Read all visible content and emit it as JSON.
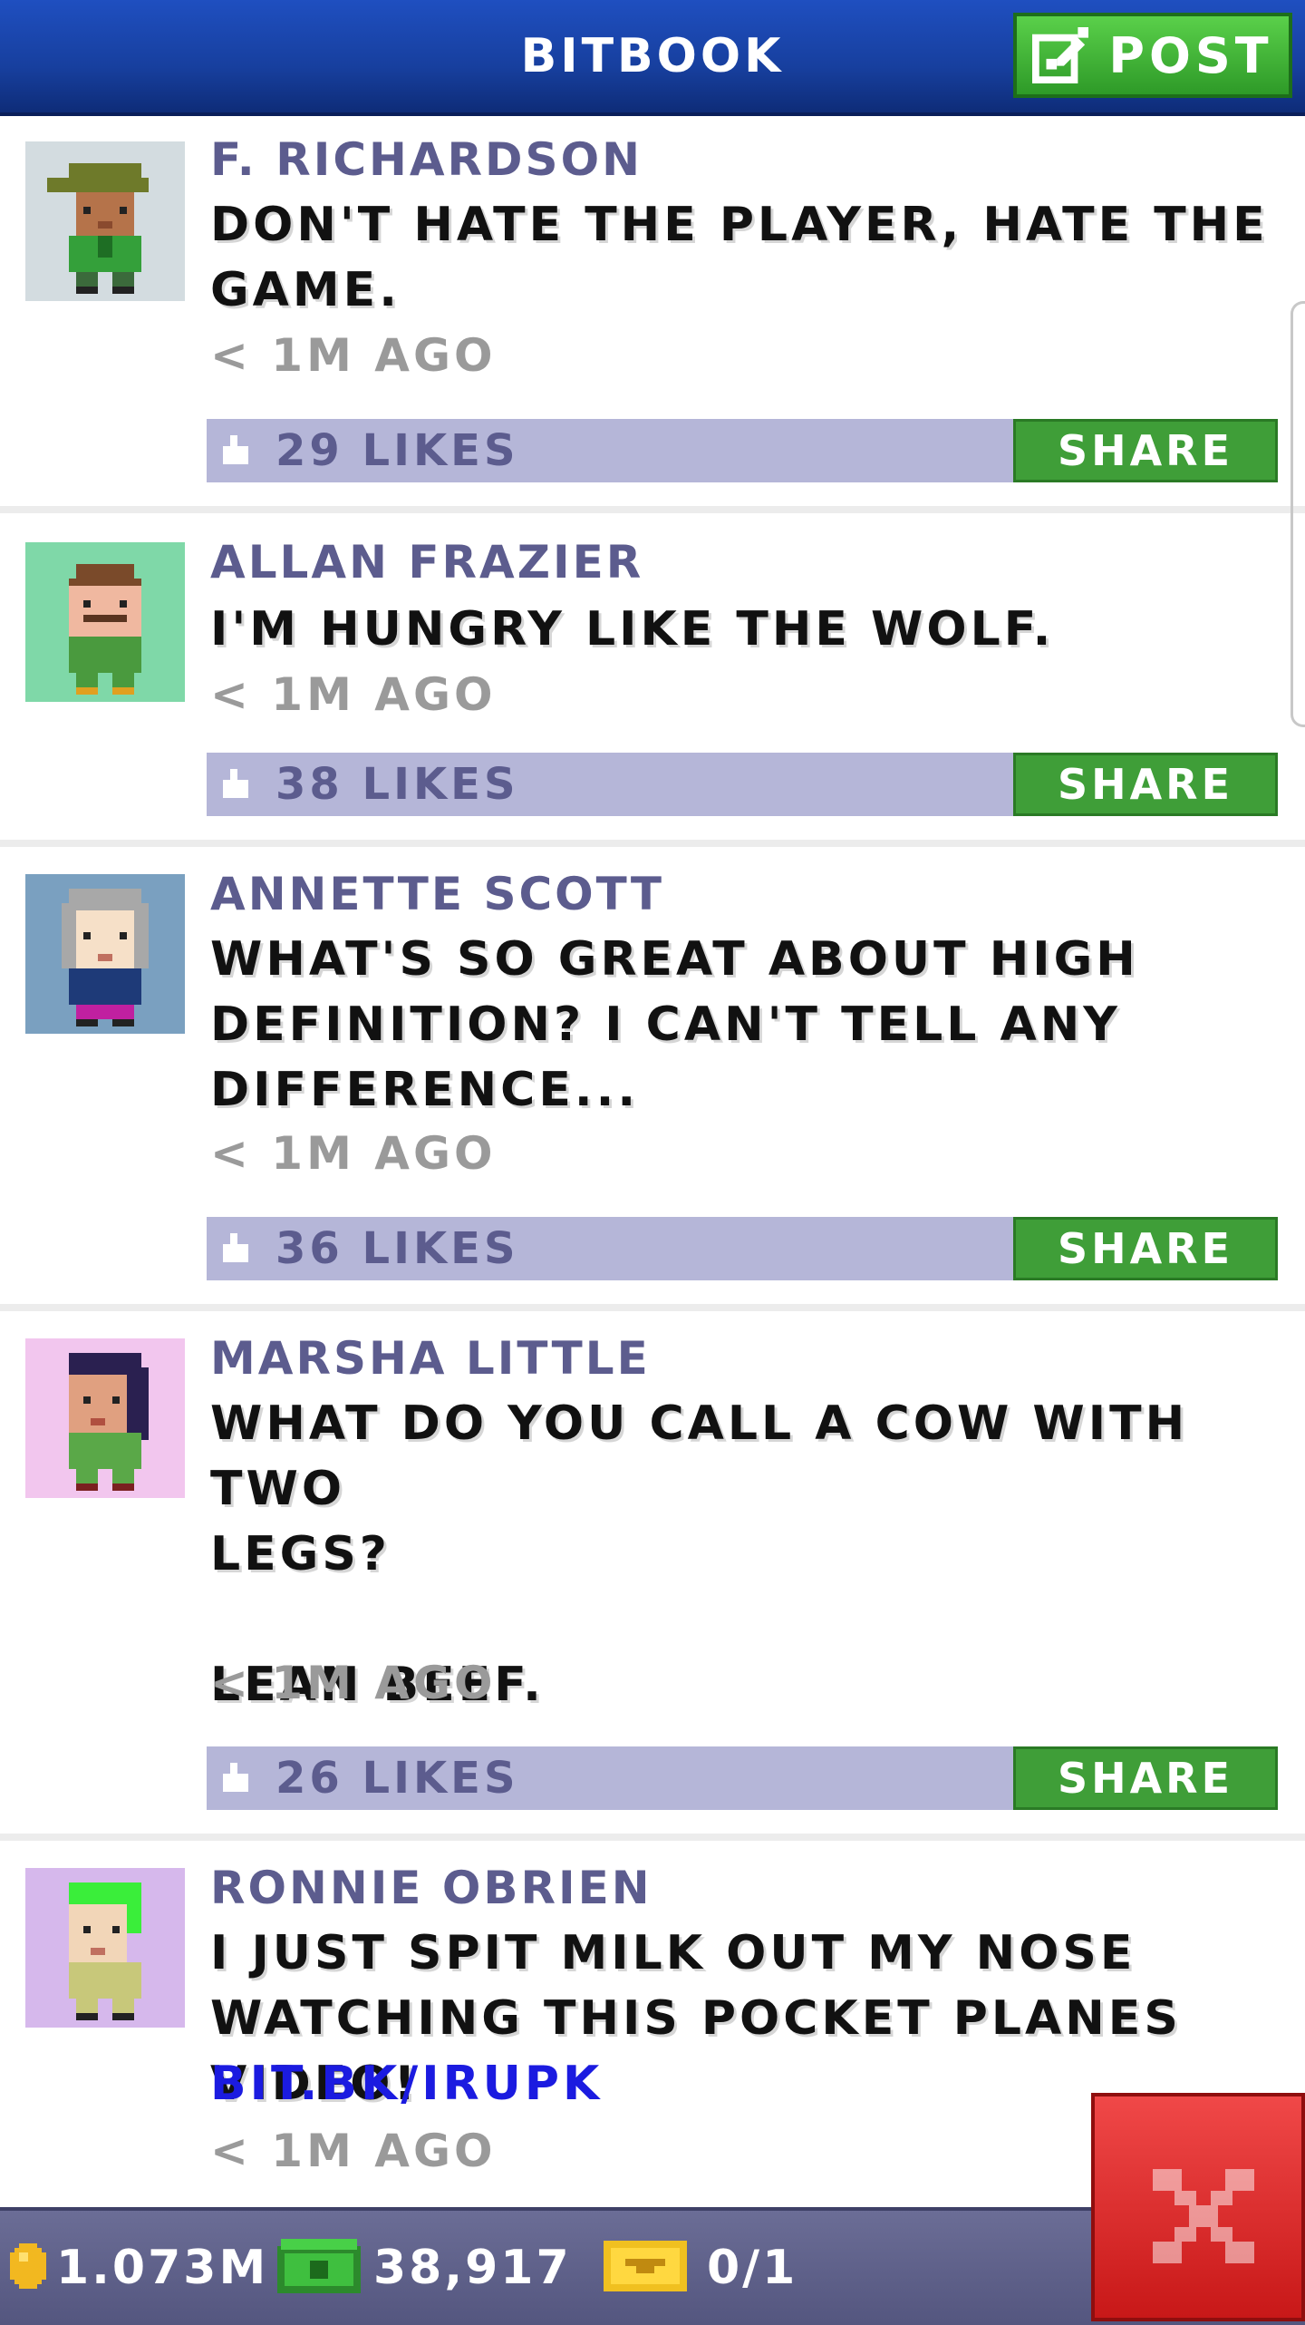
{
  "header": {
    "title": "BITBOOK",
    "post_label": "POST"
  },
  "posts": [
    {
      "author": "F. RICHARDSON",
      "message": "DON'T HATE THE PLAYER, HATE THE\nGAME.",
      "link": "",
      "time": "< 1M AGO",
      "likes": "29 LIKES",
      "share_label": "SHARE",
      "avatar": "man-cap-avatar"
    },
    {
      "author": "ALLAN FRAZIER",
      "message": "I'M HUNGRY LIKE THE WOLF.",
      "link": "",
      "time": "< 1M AGO",
      "likes": "38 LIKES",
      "share_label": "SHARE",
      "avatar": "man-mustache-avatar"
    },
    {
      "author": "ANNETTE SCOTT",
      "message": "WHAT'S SO GREAT ABOUT HIGH\nDEFINITION? I CAN'T TELL ANY\nDIFFERENCE...",
      "link": "",
      "time": "< 1M AGO",
      "likes": "36 LIKES",
      "share_label": "SHARE",
      "avatar": "old-woman-avatar"
    },
    {
      "author": "MARSHA LITTLE",
      "message": "WHAT DO YOU CALL A COW WITH TWO\nLEGS?\n\nLEAN BEEF.",
      "link": "",
      "time": "< 1M AGO",
      "likes": "26 LIKES",
      "share_label": "SHARE",
      "avatar": "woman-dark-hair-avatar"
    },
    {
      "author": "RONNIE OBRIEN",
      "message": "I JUST SPIT MILK OUT MY NOSE\nWATCHING THIS POCKET PLANES VIDEO!",
      "link": "BIT.BK/IRUPK",
      "time": "< 1M AGO",
      "likes": "",
      "share_label": "",
      "avatar": "man-green-hair-avatar"
    }
  ],
  "status_bar": {
    "coins": "1.073M",
    "bux": "38,917",
    "tickets": "0/1"
  },
  "colors": {
    "header_blue": "#1f4fc0",
    "accent_green": "#3f9e38",
    "likes_bar": "#b5b6d8",
    "author": "#5c5c8e",
    "close_red": "#e03030"
  }
}
